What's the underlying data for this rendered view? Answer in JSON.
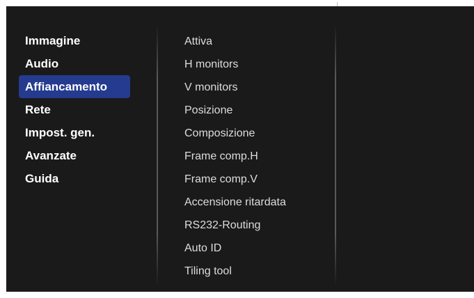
{
  "menu": {
    "main_items": [
      {
        "label": "Immagine"
      },
      {
        "label": "Audio"
      },
      {
        "label": "Affiancamento",
        "selected": true
      },
      {
        "label": "Rete"
      },
      {
        "label": "Impost. gen."
      },
      {
        "label": "Avanzate"
      },
      {
        "label": "Guida"
      }
    ],
    "sub_items": [
      {
        "label": "Attiva"
      },
      {
        "label": "H monitors"
      },
      {
        "label": "V monitors"
      },
      {
        "label": "Posizione"
      },
      {
        "label": "Composizione"
      },
      {
        "label": "Frame comp.H"
      },
      {
        "label": "Frame comp.V"
      },
      {
        "label": "Accensione ritardata"
      },
      {
        "label": "RS232-Routing"
      },
      {
        "label": "Auto ID"
      },
      {
        "label": "Tiling tool"
      }
    ]
  },
  "colors": {
    "background": "#1a1a1a",
    "selection": "#243b8f",
    "main_text": "#ffffff",
    "sub_text": "#dddddd"
  }
}
